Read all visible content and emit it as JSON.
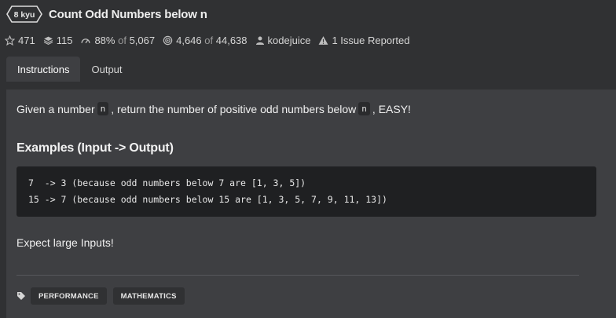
{
  "kata": {
    "rank": "8 kyu",
    "title": "Count Odd Numbers below n"
  },
  "stats": {
    "stars": "471",
    "collections": "115",
    "satisfaction_pct": "88%",
    "satisfaction_of": "of",
    "satisfaction_total": "5,067",
    "completed": "4,646",
    "completed_of": "of",
    "completed_total": "44,638",
    "author": "kodejuice",
    "issues": "1 Issue Reported"
  },
  "tabs": [
    {
      "label": "Instructions",
      "active": true
    },
    {
      "label": "Output",
      "active": false
    }
  ],
  "description": {
    "part1": "Given a number",
    "var1": "n",
    "part2": ", return the number of positive odd numbers below",
    "var2": "n",
    "part3": ", EASY!"
  },
  "examples": {
    "heading": "Examples (Input -> Output)",
    "lines": [
      "7  -> 3 (because odd numbers below 7 are [1, 3, 5])",
      "15 -> 7 (because odd numbers below 15 are [1, 3, 5, 7, 9, 11, 13])"
    ]
  },
  "note": "Expect large Inputs!",
  "tags": [
    "PERFORMANCE",
    "MATHEMATICS"
  ],
  "colors": {
    "background": "#303133",
    "panel": "#3e3f42",
    "code_bg": "#1f2022"
  }
}
